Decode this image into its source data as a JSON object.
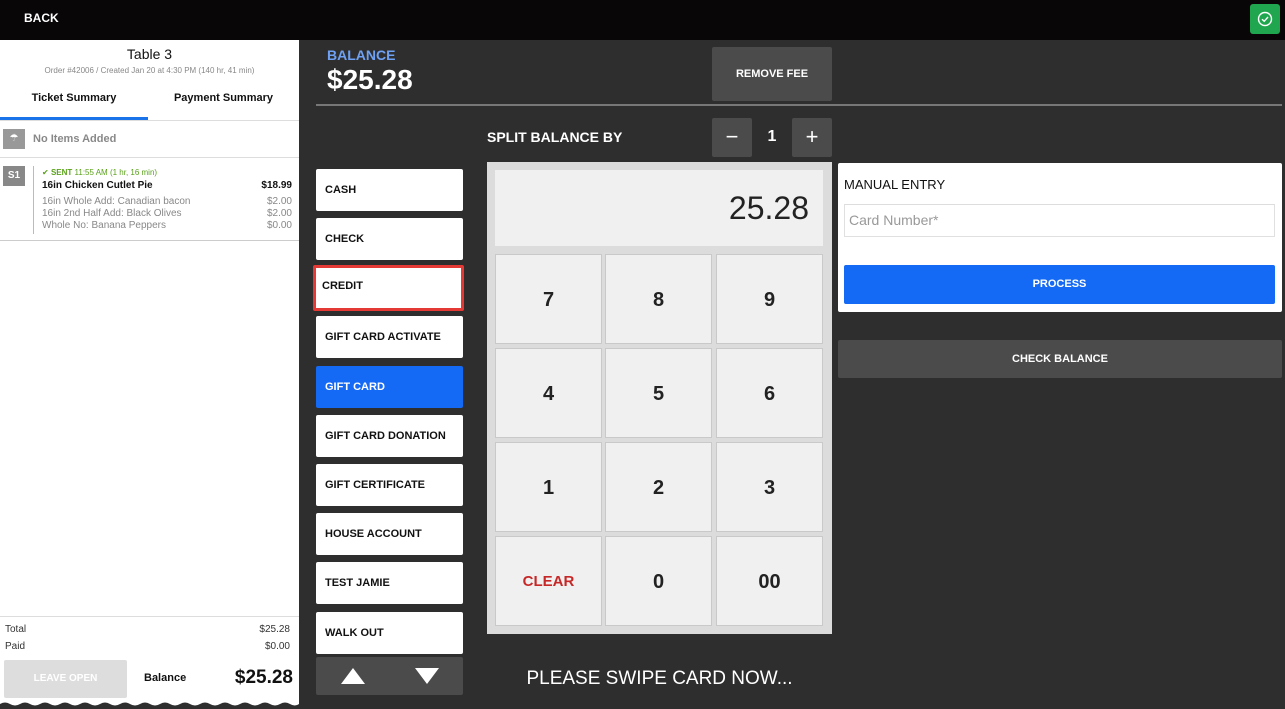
{
  "topbar": {
    "back_label": "BACK"
  },
  "ticket": {
    "title": "Table 3",
    "subtitle": "Order #42006 / Created Jan 20 at 4:30 PM (140 hr, 41 min)",
    "tabs": [
      "Ticket Summary",
      "Payment Summary"
    ],
    "no_items_label": "No Items Added",
    "seat_label": "S1",
    "sent_status": "SENT",
    "sent_time": "11:55 AM (1 hr, 16 min)",
    "item_name": "16in Chicken Cutlet Pie",
    "item_price": "$18.99",
    "modifiers": [
      {
        "text": "16in Whole Add: Canadian bacon",
        "price": "$2.00"
      },
      {
        "text": "16in 2nd Half Add: Black Olives",
        "price": "$2.00"
      },
      {
        "text": "Whole No: Banana Peppers",
        "price": "$0.00"
      }
    ],
    "total_label": "Total",
    "total_value": "$25.28",
    "paid_label": "Paid",
    "paid_value": "$0.00",
    "leave_open_label": "LEAVE OPEN",
    "balance_label": "Balance",
    "balance_value": "$25.28"
  },
  "balance": {
    "label": "BALANCE",
    "value": "$25.28",
    "remove_fee_label": "REMOVE FEE"
  },
  "split": {
    "label": "SPLIT BALANCE BY",
    "value": "1",
    "minus": "−",
    "plus": "+"
  },
  "tenders": [
    "CASH",
    "CHECK",
    "CREDIT",
    "GIFT CARD ACTIVATE",
    "GIFT CARD",
    "GIFT CARD DONATION",
    "GIFT CERTIFICATE",
    "HOUSE ACCOUNT",
    "TEST JAMIE",
    "WALK OUT"
  ],
  "keypad": {
    "display": "25.28",
    "keys": [
      "7",
      "8",
      "9",
      "4",
      "5",
      "6",
      "1",
      "2",
      "3",
      "CLEAR",
      "0",
      "00"
    ]
  },
  "swipe_message": "PLEASE SWIPE CARD NOW...",
  "manual": {
    "label": "MANUAL ENTRY",
    "card_placeholder": "Card Number*",
    "process_label": "PROCESS"
  },
  "check_balance_label": "CHECK BALANCE",
  "colors": {
    "accent": "#1469f5",
    "balance_label": "#6ea1f3",
    "confirm": "#1fa64e",
    "clear": "#c62828",
    "selected_outline": "#e53935"
  }
}
